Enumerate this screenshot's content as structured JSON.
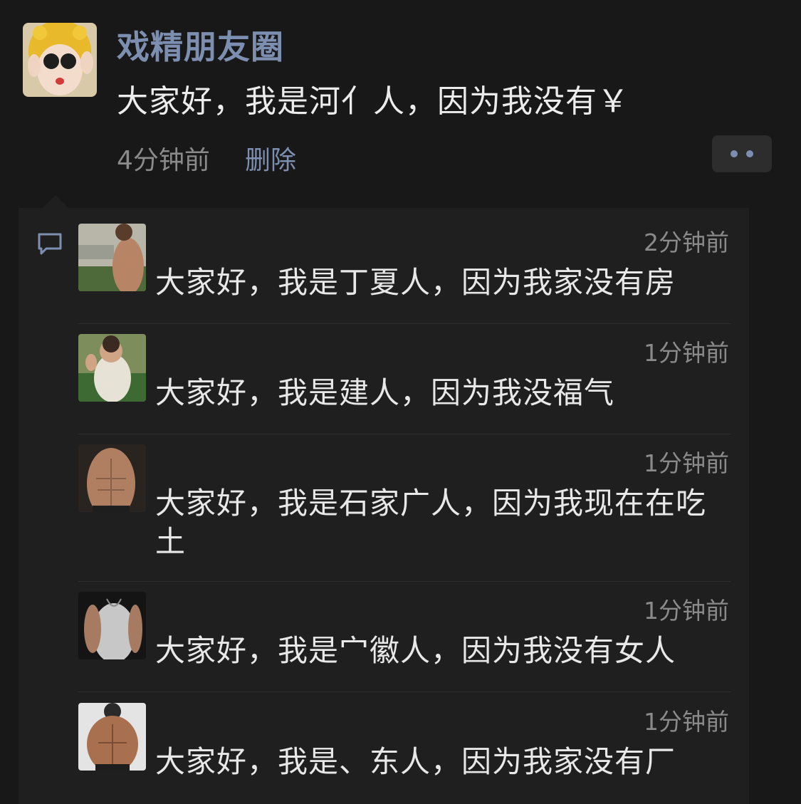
{
  "post": {
    "author": "戏精朋友圈",
    "text": "大家好，我是河⺅人，因为我没有￥",
    "time": "4分钟前",
    "delete_label": "删除"
  },
  "comments": [
    {
      "time": "2分钟前",
      "text": "大家好，我是丁夏人，因为我家没有房"
    },
    {
      "time": "1分钟前",
      "text": "大家好，我是建人，因为我没福气"
    },
    {
      "time": "1分钟前",
      "text": "大家好，我是石家广人，因为我现在在吃土"
    },
    {
      "time": "1分钟前",
      "text": "大家好，我是⼧徽人，因为我没有女人"
    },
    {
      "time": "1分钟前",
      "text": "大家好，我是、东人，因为我家没有厂"
    }
  ],
  "icons": {
    "more": "more-dots-icon",
    "comment": "comment-bubble-icon"
  },
  "colors": {
    "background": "#181818",
    "panel": "#1f1f1f",
    "link": "#7d8fb0",
    "muted": "#8a8a8a"
  }
}
